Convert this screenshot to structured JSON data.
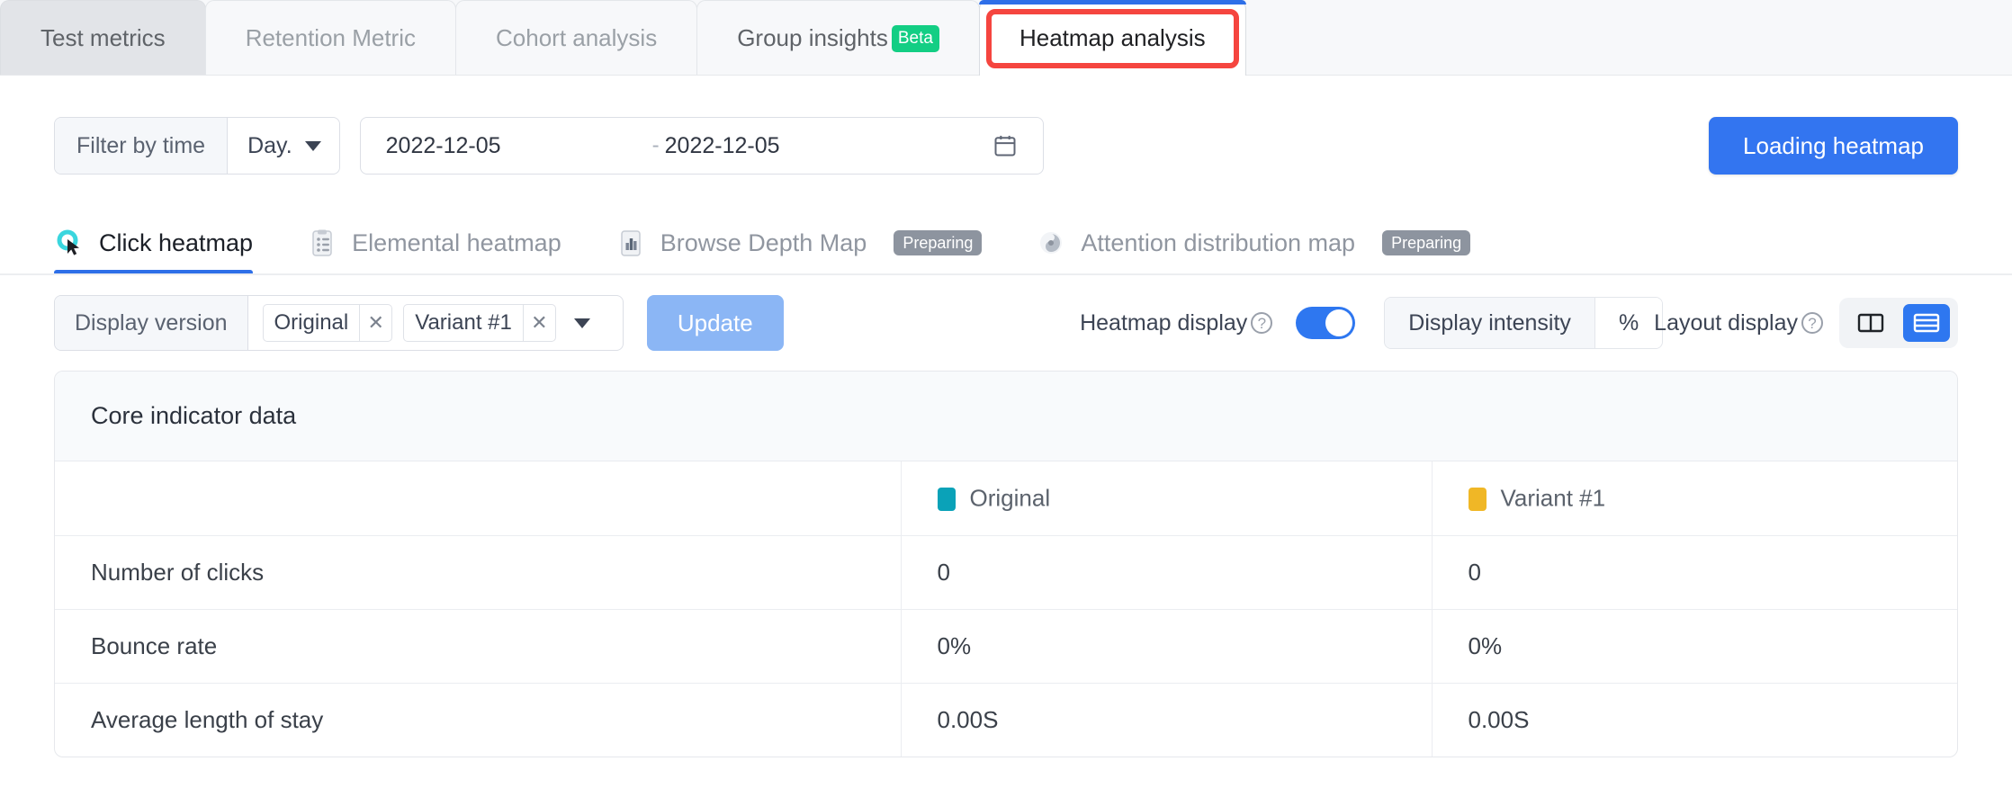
{
  "top_tabs": [
    {
      "label": "Test metrics",
      "state": "dim-dark"
    },
    {
      "label": "Retention Metric",
      "state": "dim"
    },
    {
      "label": "Cohort analysis",
      "state": "dim"
    },
    {
      "label": "Group insights",
      "badge": "Beta",
      "state": "semi"
    },
    {
      "label": "Heatmap analysis",
      "state": "active"
    }
  ],
  "filter": {
    "label": "Filter by time",
    "granularity": "Day.",
    "start_date": "2022-12-05",
    "separator": "-",
    "end_date": "2022-12-05",
    "calendar_icon": "calendar-icon"
  },
  "load_button": "Loading heatmap",
  "sub_tabs": [
    {
      "label": "Click heatmap",
      "icon": "click-target-icon",
      "active": true
    },
    {
      "label": "Elemental heatmap",
      "icon": "clipboard-list-icon",
      "active": false
    },
    {
      "label": "Browse Depth Map",
      "icon": "bar-chart-icon",
      "active": false,
      "badge": "Preparing"
    },
    {
      "label": "Attention distribution map",
      "icon": "eye-swirl-icon",
      "active": false,
      "badge": "Preparing"
    }
  ],
  "controls": {
    "version_label": "Display version",
    "version_tags": [
      "Original",
      "Variant #1"
    ],
    "update_button": "Update",
    "heatmap_display_label": "Heatmap display",
    "heatmap_display_on": true,
    "intensity_segments": [
      {
        "label": "Display intensity",
        "selected": false
      },
      {
        "label": "%",
        "selected": true
      }
    ],
    "layout_display_label": "Layout display",
    "layout_modes": [
      {
        "icon": "columns-layout-icon",
        "selected": false
      },
      {
        "icon": "rows-layout-icon",
        "selected": true
      }
    ]
  },
  "table": {
    "title": "Core indicator data",
    "columns": [
      {
        "label": "",
        "color": ""
      },
      {
        "label": "Original",
        "color": "#0aa2b8"
      },
      {
        "label": "Variant #1",
        "color": "#f0b726"
      }
    ],
    "rows": [
      {
        "metric": "Number of clicks",
        "original": "0",
        "variant1": "0"
      },
      {
        "metric": "Bounce rate",
        "original": "0%",
        "variant1": "0%"
      },
      {
        "metric": "Average length of stay",
        "original": "0.00S",
        "variant1": "0.00S"
      }
    ]
  },
  "colors": {
    "accent_blue": "#3375f0",
    "annotation_red": "#f5453f",
    "beta_green": "#13ce84",
    "preparing_grey": "#8d949f"
  }
}
